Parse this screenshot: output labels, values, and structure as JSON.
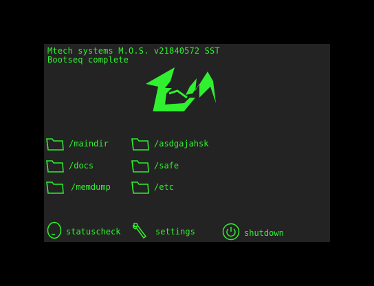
{
  "header": {
    "line1": "Mtech systems M.O.S. v21840572 SST",
    "line2": "Bootseq complete"
  },
  "logo": {
    "icon": "dm-logo-icon"
  },
  "folders": [
    {
      "label": "/maindir",
      "icon": "folder-icon"
    },
    {
      "label": "/asdgajahsk",
      "icon": "folder-icon"
    },
    {
      "label": "/docs",
      "icon": "folder-icon"
    },
    {
      "label": "/safe",
      "icon": "folder-icon"
    },
    {
      "label": "/memdump",
      "icon": "folder-icon"
    },
    {
      "label": "/etc",
      "icon": "folder-icon"
    }
  ],
  "actions": {
    "statuscheck": {
      "label": "statuscheck",
      "icon": "status-icon"
    },
    "settings": {
      "label": "settings",
      "icon": "wrench-icon"
    },
    "shutdown": {
      "label": "shutdown",
      "icon": "power-icon"
    }
  },
  "colors": {
    "accent": "#30f030",
    "screen_bg": "#232323",
    "outer_bg": "#000000"
  }
}
